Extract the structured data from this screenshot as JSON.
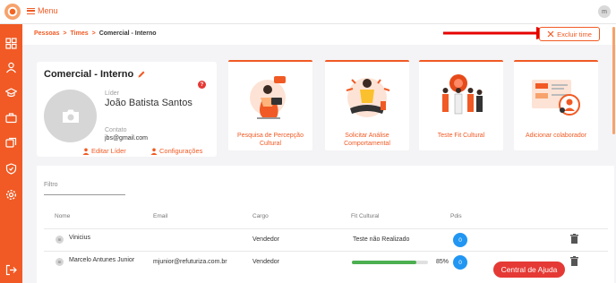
{
  "topbar": {
    "menu_label": "Menu",
    "user_initial": "m"
  },
  "sidebar": {
    "items": [
      "dashboard-icon",
      "people-icon",
      "graduation-icon",
      "briefcase-icon",
      "copy-icon",
      "shield-icon",
      "gear-icon"
    ],
    "logout_icon": "logout-icon"
  },
  "breadcrumb": {
    "items": [
      "Pessoas",
      "Times",
      "Comercial - Interno"
    ],
    "separator": ">"
  },
  "header": {
    "delete_label": "Excluir time",
    "accent": "#f15a24"
  },
  "team": {
    "title": "Comercial - Interno",
    "help": "?",
    "leader_label": "Líder",
    "leader_name": "João Batista Santos",
    "contact_label": "Contato",
    "contact_email": "jbs@gmail.com",
    "edit_leader": "Editar Líder",
    "settings": "Configurações"
  },
  "actions": [
    {
      "label": "Pesquisa de Percepção Cultural"
    },
    {
      "label": "Solicitar Análise Comportamental"
    },
    {
      "label": "Teste Fit Cultural"
    },
    {
      "label": "Adicionar colaborador"
    }
  ],
  "table": {
    "filter_label": "Filtro",
    "headers": [
      "Nome",
      "Email",
      "Cargo",
      "Fit Cultural",
      "Pdis"
    ],
    "rows": [
      {
        "initial": "m",
        "name": "Vinicius",
        "email": "",
        "cargo": "Vendedor",
        "fit_text": "Teste não Realizado",
        "fit_pct": null,
        "pdis": "0"
      },
      {
        "initial": "m",
        "name": "Marcelo Antunes Junior",
        "email": "mjunior@refuturiza.com.br",
        "cargo": "Vendedor",
        "fit_text": "85%",
        "fit_pct": 85,
        "pdis": "0"
      }
    ]
  },
  "help_button": "Central de Ajuda",
  "colors": {
    "primary": "#f15a24",
    "danger": "#e53935",
    "badge": "#2196f3",
    "progress": "#4caf50"
  }
}
